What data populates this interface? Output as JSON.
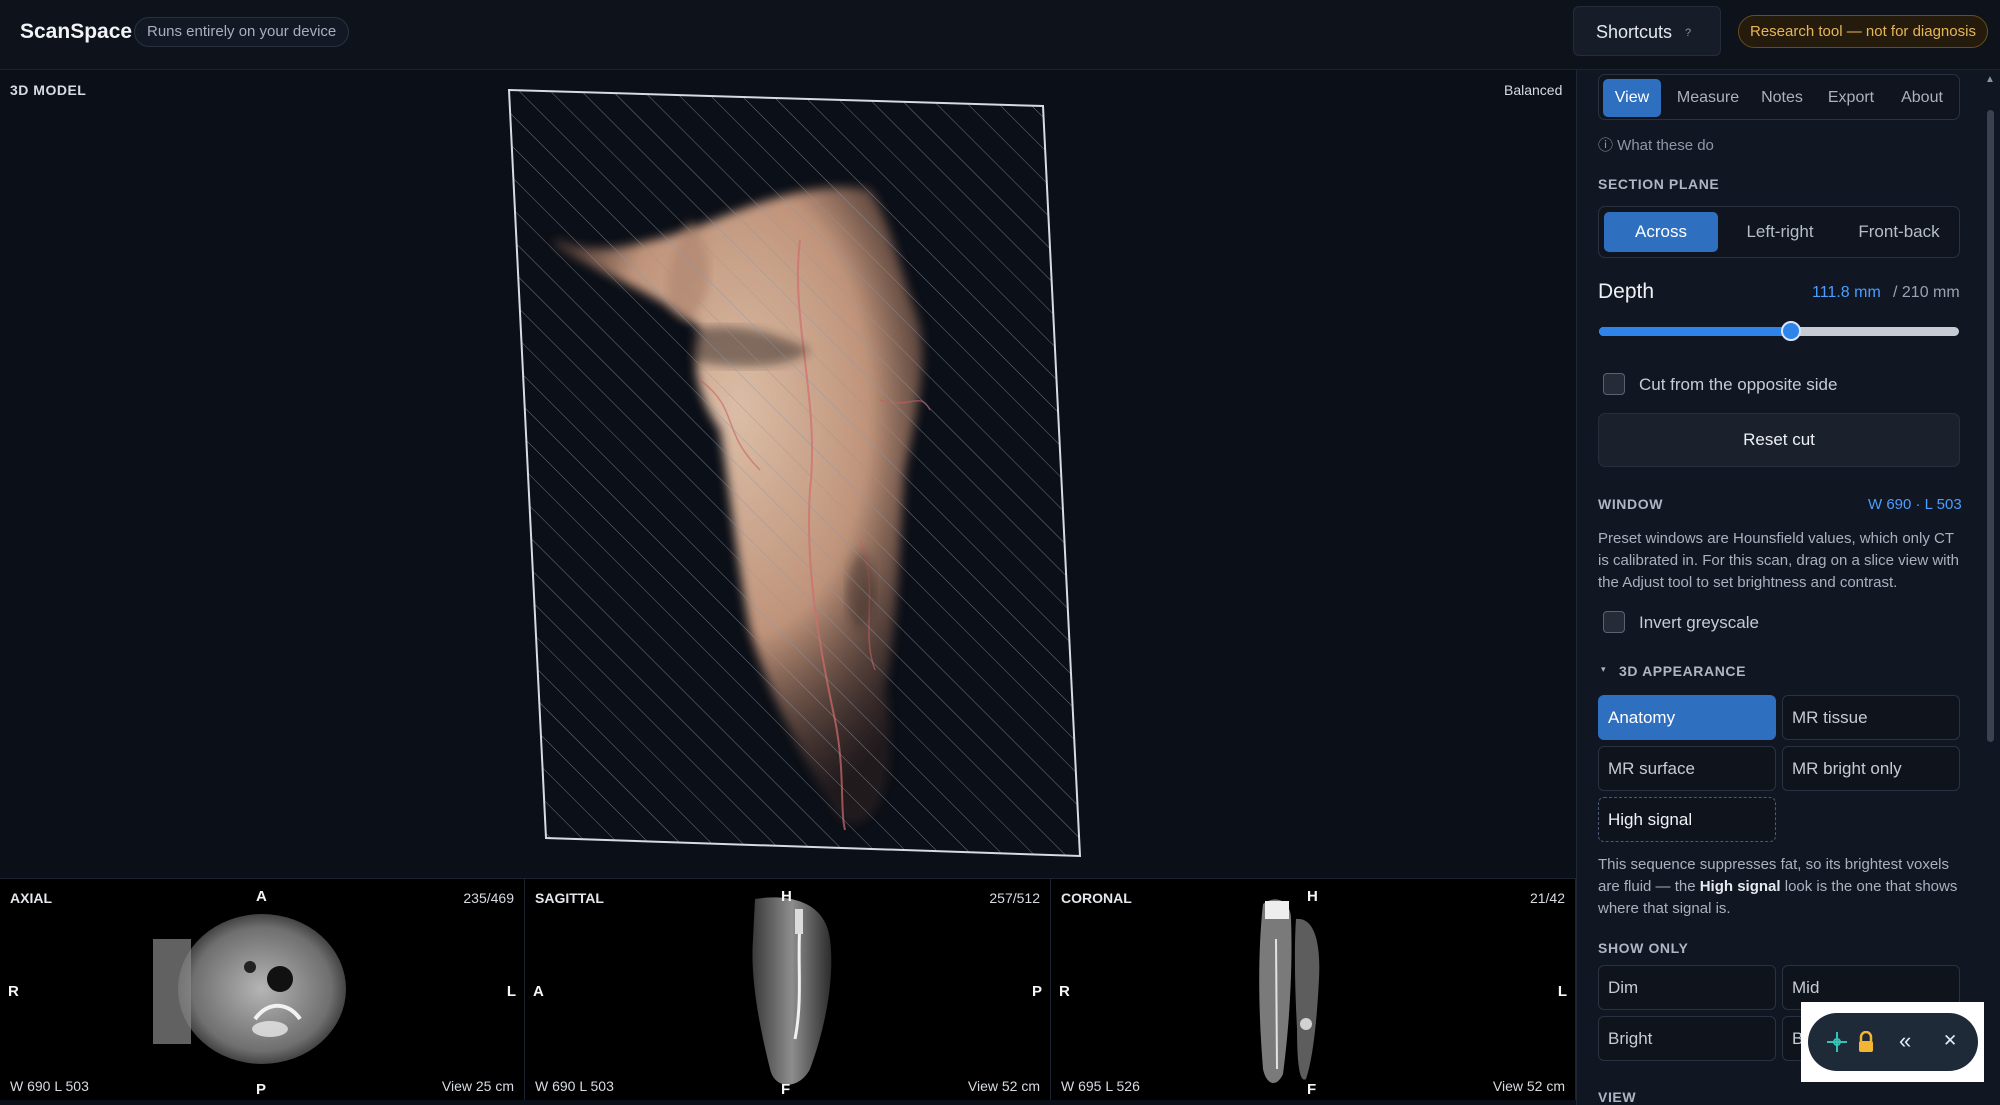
{
  "header": {
    "app_name": "ScanSpace",
    "tagline": "Runs entirely on your device",
    "shortcuts_label": "Shortcuts",
    "shortcuts_hint": "?",
    "warning_badge": "Research tool — not for diagnosis"
  },
  "viewport": {
    "title": "3D MODEL",
    "quality": "Balanced"
  },
  "slices": {
    "axial": {
      "title": "AXIAL",
      "count": "235/469",
      "top": "A",
      "bottom": "P",
      "left": "R",
      "right": "L",
      "wl": "W 690 L 503",
      "view": "View 25 cm"
    },
    "sagittal": {
      "title": "SAGITTAL",
      "count": "257/512",
      "top": "H",
      "bottom": "F",
      "left": "A",
      "right": "P",
      "wl": "W 690 L 503",
      "view": "View 52 cm"
    },
    "coronal": {
      "title": "CORONAL",
      "count": "21/42",
      "top": "H",
      "bottom": "F",
      "left": "R",
      "right": "L",
      "wl": "W 695 L 526",
      "view": "View 52 cm"
    }
  },
  "panel": {
    "tabs": [
      "View",
      "Measure",
      "Notes",
      "Export",
      "About"
    ],
    "active_tab": "View",
    "what_these_do": "ⓘ What these do",
    "section_plane": {
      "title": "SECTION PLANE",
      "options": [
        "Across",
        "Left-right",
        "Front-back"
      ],
      "active": "Across"
    },
    "depth": {
      "label": "Depth",
      "value": "111.8 mm",
      "max": "/ 210 mm",
      "fraction": 0.532
    },
    "cut_opposite": {
      "label": "Cut from the opposite side",
      "checked": false
    },
    "reset_cut": "Reset cut",
    "window": {
      "title": "WINDOW",
      "value": "W 690 · L 503",
      "description": "Preset windows are Hounsfield values, which only CT is calibrated in. For this scan, drag on a slice view with the Adjust tool to set brightness and contrast."
    },
    "invert": {
      "label": "Invert greyscale",
      "checked": false
    },
    "appearance": {
      "title": "3D APPEARANCE",
      "caret": "▾",
      "options": [
        "Anatomy",
        "MR tissue",
        "MR surface",
        "MR bright only",
        "High signal"
      ],
      "active": "Anatomy",
      "desc_before": "This sequence suppresses fat, so its brightest voxels are fluid — the ",
      "desc_bold": "High signal",
      "desc_after": " look is the one that shows where that signal is."
    },
    "show_only": {
      "title": "SHOW ONLY",
      "options": [
        "Dim",
        "Mid",
        "Bright",
        "B"
      ]
    },
    "next_section": "VIEW"
  },
  "floating_toolbar": {
    "icons": [
      "crosshair-icon",
      "lock-icon",
      "collapse-icon",
      "close-icon"
    ],
    "collapse_glyph": "«",
    "close_glyph": "✕"
  },
  "colors": {
    "accent": "#2f6fc0",
    "accent_text": "#4b9dff",
    "warning": "#e7b557",
    "background": "#0b0f17"
  }
}
